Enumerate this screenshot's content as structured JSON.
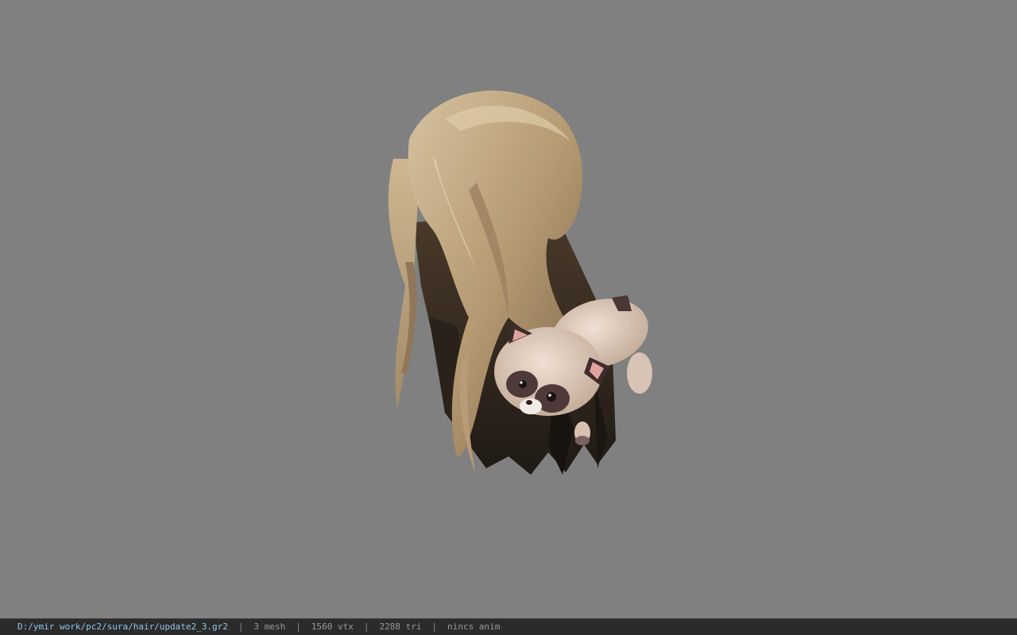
{
  "viewport": {
    "background_color": "#808080",
    "model": {
      "icon": "hair-model-icon",
      "attachment_icon": "raccoon-plush-icon"
    }
  },
  "statusbar": {
    "file_path": "D:/ymir work/pc2/sura/hair/update2_3.gr2",
    "separator": "|",
    "mesh_count": "3 mesh",
    "vertex_count": "1560 vtx",
    "triangle_count": "2288 tri",
    "anim_status": "nincs anim",
    "path_color": "#8fc6e8",
    "text_color": "#9a9a9a"
  }
}
